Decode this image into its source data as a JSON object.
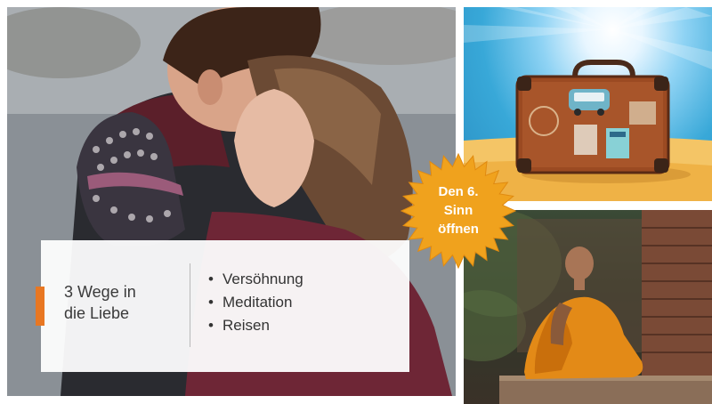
{
  "card": {
    "title_line1": "3 Wege in",
    "title_line2": "die Liebe",
    "bullet_symbol": "•",
    "items": [
      "Versöhnung",
      "Meditation",
      "Reisen"
    ]
  },
  "badge": {
    "line1": "Den 6.",
    "line2": "Sinn",
    "line3": "öffnen",
    "color": "#f0a21d"
  },
  "colors": {
    "accent": "#e87722",
    "text": "#333333"
  }
}
